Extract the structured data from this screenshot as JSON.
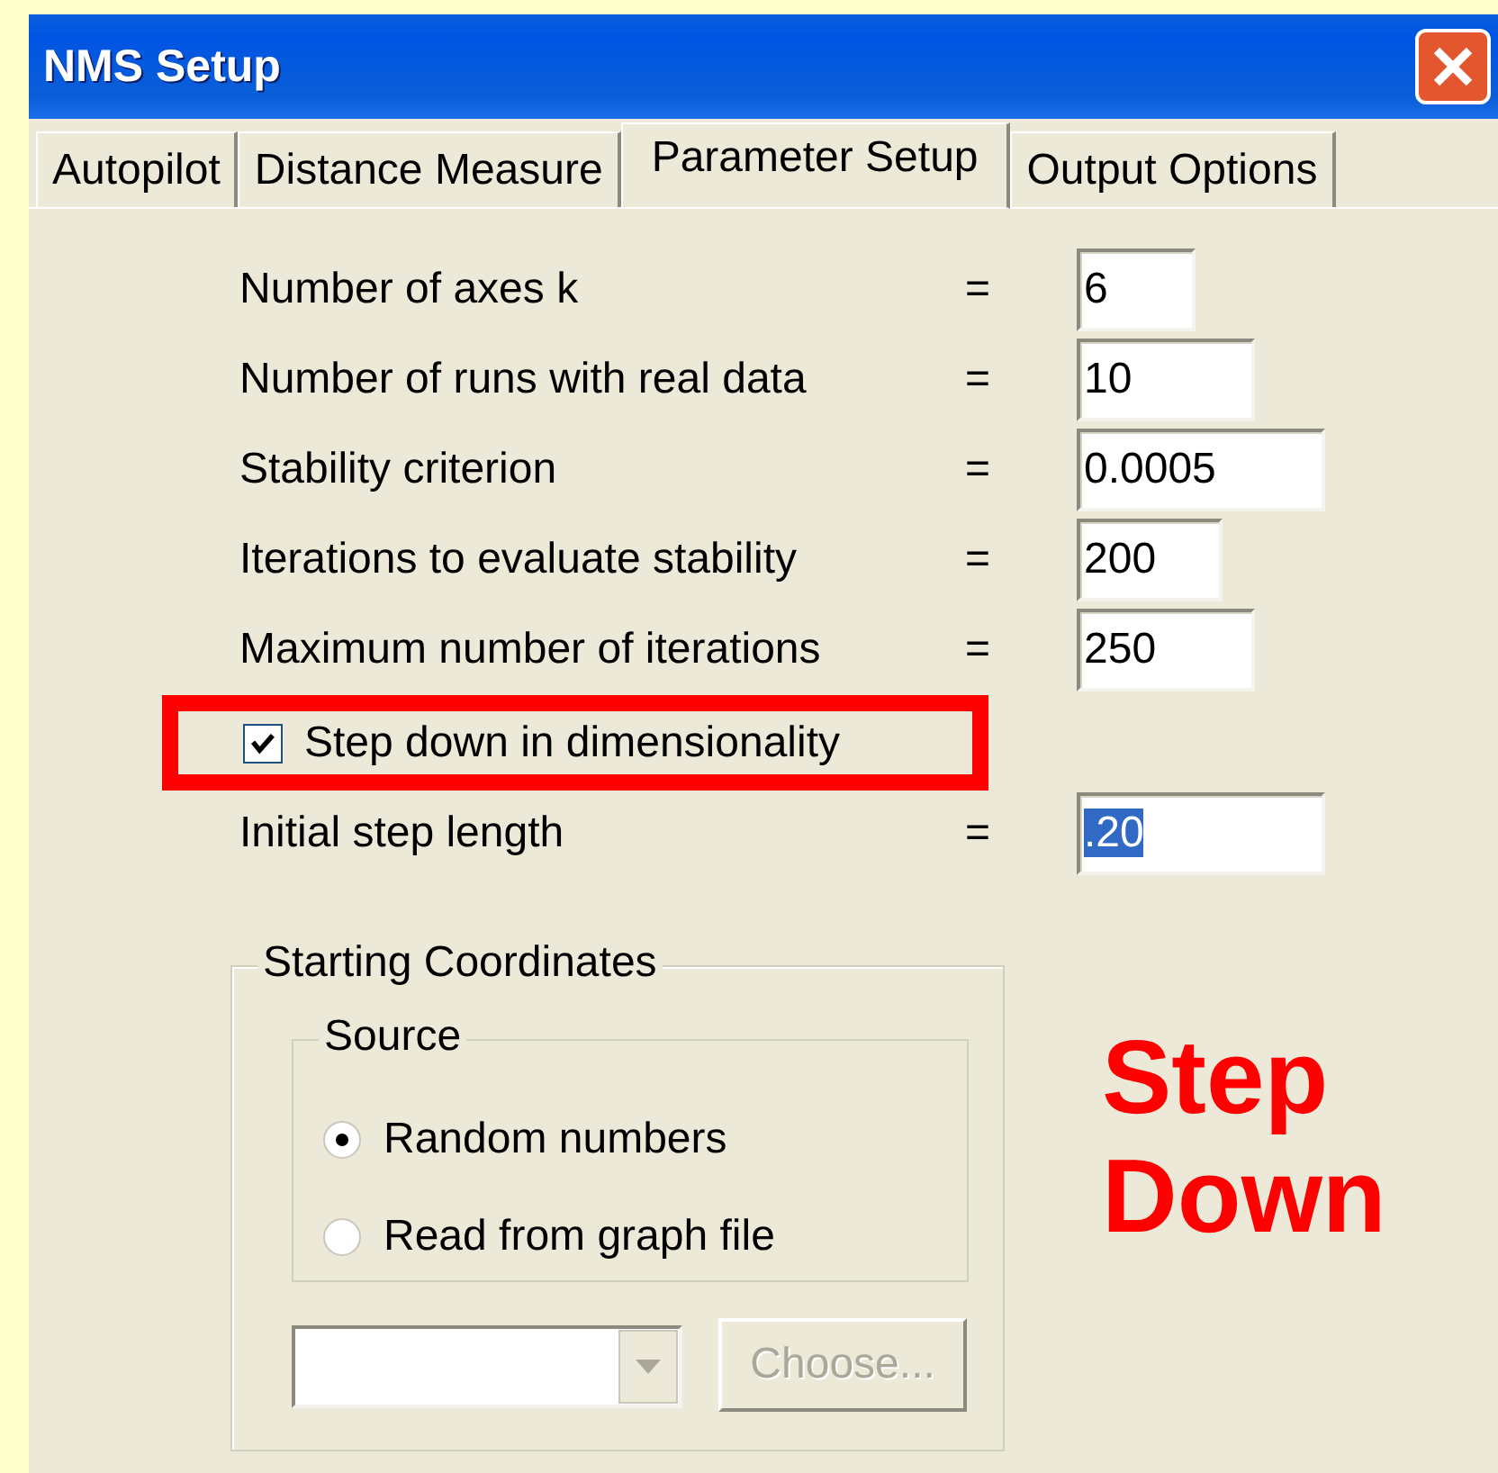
{
  "window": {
    "title": "NMS Setup"
  },
  "tabs": [
    {
      "label": "Autopilot",
      "selected": false
    },
    {
      "label": "Distance Measure",
      "selected": false
    },
    {
      "label": "Parameter Setup",
      "selected": true
    },
    {
      "label": "Output Options",
      "selected": false
    }
  ],
  "parameters": [
    {
      "label": "Number of axes k",
      "equals": "=",
      "value": "6",
      "text_selected": false
    },
    {
      "label": "Number of runs with real data",
      "equals": "=",
      "value": "10",
      "text_selected": false
    },
    {
      "label": "Stability criterion",
      "equals": "=",
      "value": "0.0005",
      "text_selected": false
    },
    {
      "label": "Iterations to evaluate stability",
      "equals": "=",
      "value": "200",
      "text_selected": false
    },
    {
      "label": "Maximum number of iterations",
      "equals": "=",
      "value": "250",
      "text_selected": false
    }
  ],
  "step_down": {
    "label": "Step down in dimensionality",
    "checked": true,
    "highlighted": true
  },
  "initial_step": {
    "label": "Initial step length",
    "equals": "=",
    "value": ".20",
    "text_selected": true
  },
  "starting_coordinates": {
    "title": "Starting Coordinates",
    "source": {
      "title": "Source",
      "options": [
        {
          "label": "Random numbers",
          "selected": true
        },
        {
          "label": "Read from graph file",
          "selected": false
        }
      ]
    },
    "file_combo": {
      "disabled": true
    },
    "choose_button": {
      "label": "Choose...",
      "disabled": true
    }
  },
  "callout": {
    "lines": [
      "Step",
      "Down"
    ]
  }
}
